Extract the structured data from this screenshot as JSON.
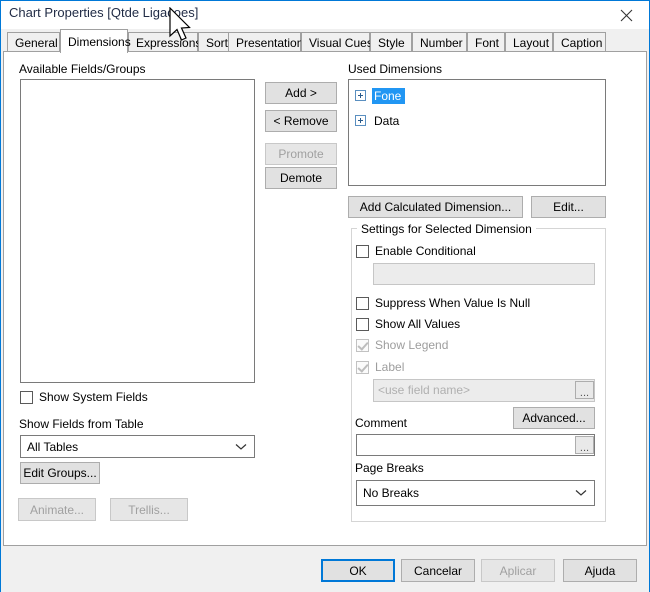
{
  "window": {
    "title": "Chart Properties [Qtde Ligacoes]",
    "close_icon": "close-icon",
    "accent_color": "#0078d7"
  },
  "tabs": [
    {
      "label": "General",
      "active": false
    },
    {
      "label": "Dimensions",
      "active": true
    },
    {
      "label": "Expressions",
      "active": false
    },
    {
      "label": "Sort",
      "active": false
    },
    {
      "label": "Presentation",
      "active": false
    },
    {
      "label": "Visual Cues",
      "active": false
    },
    {
      "label": "Style",
      "active": false
    },
    {
      "label": "Number",
      "active": false
    },
    {
      "label": "Font",
      "active": false
    },
    {
      "label": "Layout",
      "active": false
    },
    {
      "label": "Caption",
      "active": false
    }
  ],
  "left_panel": {
    "available_fields_label": "Available Fields/Groups",
    "available_fields_items": [],
    "show_system_fields": {
      "label": "Show System Fields",
      "checked": false,
      "disabled": false
    },
    "show_fields_from_table_label": "Show Fields from Table",
    "table_filter": {
      "value": "All Tables",
      "options": [
        "All Tables"
      ]
    },
    "edit_groups_button": "Edit Groups...",
    "animate_button": {
      "label": "Animate...",
      "disabled": true
    },
    "trellis_button": {
      "label": "Trellis...",
      "disabled": true
    }
  },
  "transfer_buttons": {
    "add": {
      "label": "Add >",
      "disabled": false
    },
    "remove": {
      "label": "< Remove",
      "disabled": false
    },
    "promote": {
      "label": "Promote",
      "disabled": true
    },
    "demote": {
      "label": "Demote",
      "disabled": false
    }
  },
  "right_panel": {
    "used_dimensions_label": "Used Dimensions",
    "used_dimensions": [
      {
        "label": "Fone",
        "selected": true,
        "expander": "plus-icon"
      },
      {
        "label": "Data",
        "selected": false,
        "expander": "plus-icon"
      }
    ],
    "add_calculated_dimension_button": "Add Calculated Dimension...",
    "edit_button": "Edit...",
    "settings_group_title": "Settings for Selected Dimension",
    "enable_conditional": {
      "label": "Enable Conditional",
      "checked": false,
      "disabled": false
    },
    "conditional_expression": {
      "value": "",
      "disabled": true
    },
    "suppress_when_value_is_null": {
      "label": "Suppress When Value Is Null",
      "checked": false,
      "disabled": false
    },
    "show_all_values": {
      "label": "Show All Values",
      "checked": false,
      "disabled": false
    },
    "show_legend": {
      "label": "Show Legend",
      "checked": true,
      "disabled": true
    },
    "label_check": {
      "label": "Label",
      "checked": true,
      "disabled": true
    },
    "label_field": {
      "value": "",
      "placeholder": "<use field name>",
      "disabled": true,
      "ellipsis": "..."
    },
    "advanced_button": "Advanced...",
    "comment_label": "Comment",
    "comment_field": {
      "value": "",
      "ellipsis": "..."
    },
    "page_breaks_label": "Page Breaks",
    "page_breaks": {
      "value": "No Breaks",
      "options": [
        "No Breaks"
      ]
    }
  },
  "footer": {
    "ok": {
      "label": "OK",
      "default": true,
      "disabled": false
    },
    "cancel": {
      "label": "Cancelar",
      "disabled": false
    },
    "apply": {
      "label": "Aplicar",
      "disabled": true
    },
    "help": {
      "label": "Ajuda",
      "disabled": false
    }
  }
}
